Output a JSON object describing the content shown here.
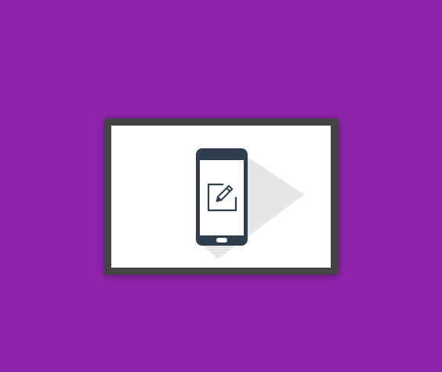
{
  "colors": {
    "background": "#8e24aa",
    "frame_border": "#444444",
    "frame_fill": "#ffffff",
    "phone_body": "#2e3e4e",
    "phone_screen": "#ffffff",
    "shadow": "#e6e6e6"
  },
  "icons": {
    "phone": "smartphone-icon",
    "edit": "edit-note-icon",
    "shadow": "long-shadow-decoration"
  }
}
